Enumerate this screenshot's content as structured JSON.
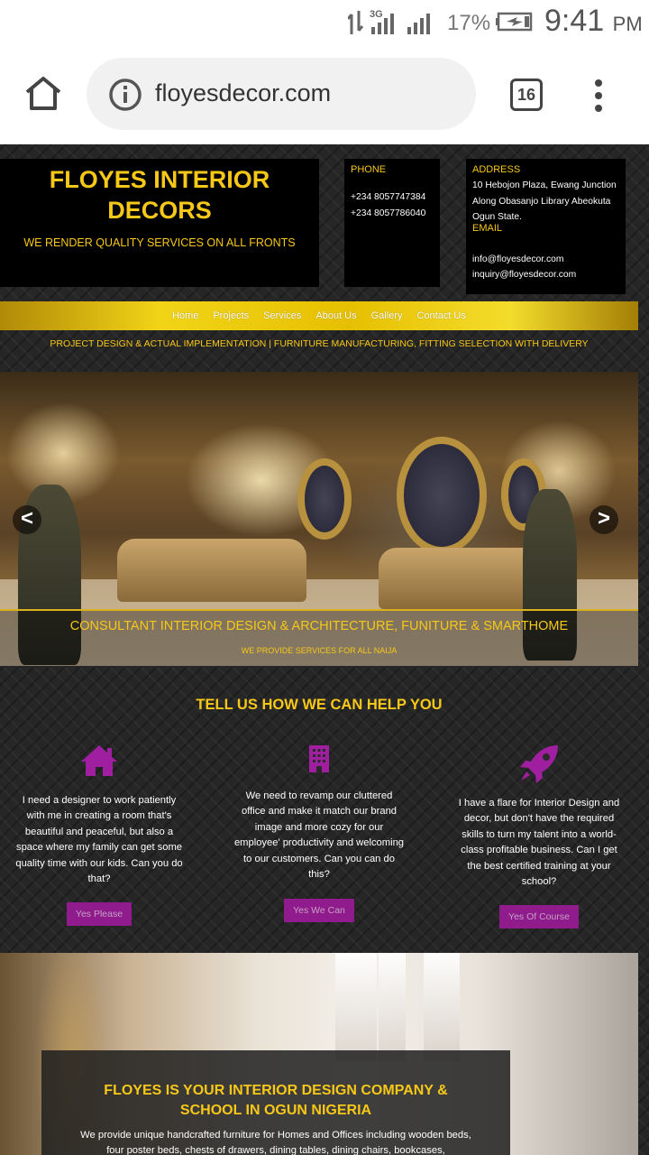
{
  "status_bar": {
    "network": "3G",
    "battery_percent": "17%",
    "time": "9:41",
    "ampm": "PM"
  },
  "browser": {
    "url": "floyesdecor.com",
    "tab_count": "16"
  },
  "header": {
    "brand_title": "FLOYES INTERIOR DECORS",
    "brand_tagline": "WE RENDER QUALITY SERVICES ON ALL FRONTS",
    "phone_label": "PHONE",
    "phones": [
      "+234 8057747384",
      "+234 8057786040"
    ],
    "address_label": "ADDRESS",
    "address": "10 Hebojon Plaza, Ewang Junction Along Obasanjo Library Abeokuta Ogun State.",
    "email_label": "EMAIL",
    "emails": [
      "info@floyesdecor.com",
      "inquiry@floyesdecor.com"
    ]
  },
  "nav": {
    "items": [
      "Home",
      "Projects",
      "Services",
      "About Us",
      "Gallery",
      "Contact Us"
    ]
  },
  "tagline": "PROJECT DESIGN & ACTUAL IMPLEMENTATION | FURNITURE MANUFACTURING, FITTING SELECTION WITH DELIVERY",
  "slider": {
    "prev": "<",
    "next": ">",
    "caption_title": "CONSULTANT INTERIOR DESIGN & ARCHITECTURE, FUNITURE & SMARTHOME",
    "caption_sub": "WE PROVIDE SERVICES FOR ALL NAIJA"
  },
  "help": {
    "title": "TELL US HOW WE CAN HELP YOU",
    "columns": [
      {
        "icon": "home-icon",
        "text": "I need a designer to work patiently with me in creating a room that's beautiful and peaceful, but also a space where my family can get some quality time with our kids. Can you do that?",
        "button": "Yes Please"
      },
      {
        "icon": "building-icon",
        "text": "We need to revamp our cluttered office and make it match our brand image and more cozy for our employee' productivity and welcoming to our customers. Can you can do this?",
        "button": "Yes We Can"
      },
      {
        "icon": "rocket-icon",
        "text": "I have a flare for Interior Design and decor, but don't have the required skills to turn my talent into a world-class profitable business. Can I get the best certified training at your school?",
        "button": "Yes Of Course"
      }
    ]
  },
  "about": {
    "title": "FLOYES IS YOUR INTERIOR DESIGN COMPANY & SCHOOL IN OGUN NIGERIA",
    "body": "We provide unique handcrafted furniture for Homes and Offices including wooden beds, four poster beds, chests of drawers, dining tables, dining chairs, bookcases,"
  },
  "colors": {
    "accent_gold": "#f7c818",
    "button_purple": "#8f1b8c",
    "icon_purple": "#a01fa0"
  }
}
